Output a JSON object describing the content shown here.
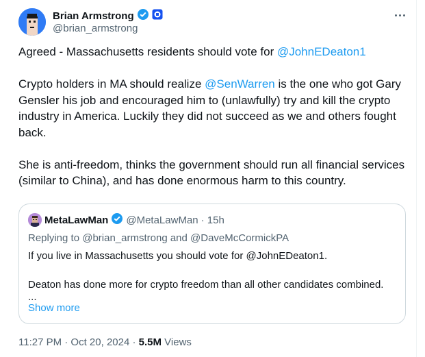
{
  "author": {
    "name": "Brian Armstrong",
    "handle": "@brian_armstrong"
  },
  "tweet": {
    "line1_prefix": "Agreed - Massachusetts residents should vote for ",
    "line1_mention": "@JohnEDeaton1",
    "p2_prefix": "Crypto holders in MA should realize ",
    "p2_mention": "@SenWarren",
    "p2_suffix": " is the one who got Gary Gensler his job and encouraged him to (unlawfully) try and kill the crypto industry in America. Luckily they did not succeed as we and others fought back.",
    "p3": "She is anti-freedom, thinks the government should run all financial services (similar to China), and has done enormous harm to this country."
  },
  "quote": {
    "name": "MetaLawMan",
    "handle": "@MetaLawMan",
    "time": "· 15h",
    "replying": "Replying to @brian_armstrong and @DaveMcCormickPA",
    "line1": "If you live in Massachusetts you should vote for @JohnEDeaton1.",
    "line2": "Deaton has done more for crypto freedom than all other candidates combined.",
    "ellipsis": "...",
    "show_more": "Show more"
  },
  "footer": {
    "time_date": "11:27 PM · Oct 20, 2024 · ",
    "views_count": "5.5M",
    "views_label": " Views"
  },
  "colors": {
    "accent": "#1d9bf0",
    "verified": "#1d9bf0",
    "affiliate_badge": "#1652f0"
  },
  "icons": {
    "verified": "verified-badge-icon",
    "affiliate": "coinbase-affiliate-icon",
    "more": "more-horizontal-icon"
  }
}
